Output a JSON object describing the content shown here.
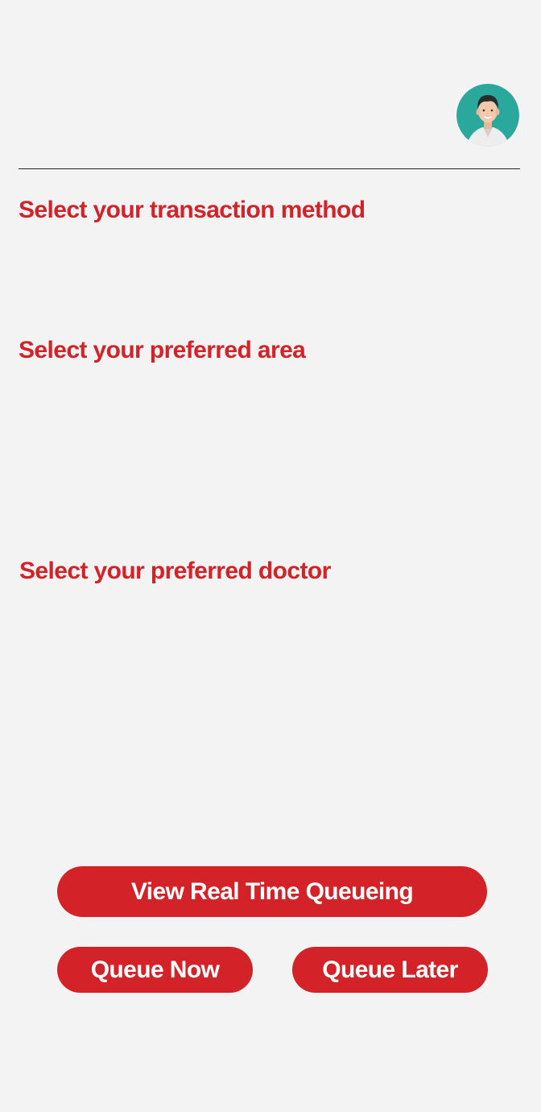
{
  "header": {
    "avatar_icon": "doctor-avatar-icon"
  },
  "sections": {
    "transaction_method_title": "Select your transaction method",
    "preferred_area_title": "Select your preferred area",
    "preferred_doctor_title": "Select your preferred doctor"
  },
  "actions": {
    "view_realtime_label": "View Real Time Queueing",
    "queue_now_label": "Queue Now",
    "queue_later_label": "Queue Later"
  },
  "colors": {
    "accent": "#d32329",
    "background": "#f3f3f3",
    "avatar_bg": "#2aa89b"
  }
}
